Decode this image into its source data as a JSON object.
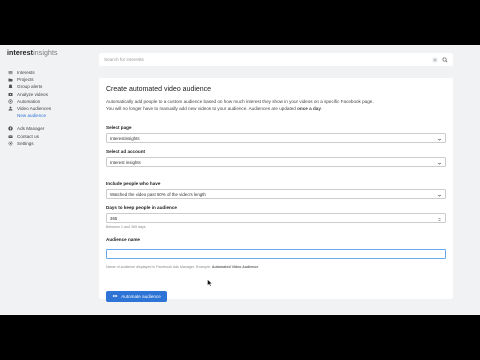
{
  "app": {
    "logo_bold": "interest",
    "logo_light": "insights"
  },
  "sidebar": {
    "items": [
      {
        "label": "Interests",
        "icon": "list-icon"
      },
      {
        "label": "Projects",
        "icon": "folder-icon"
      },
      {
        "label": "Group alerts",
        "icon": "bell-icon"
      },
      {
        "label": "Analyze videos",
        "icon": "video-icon"
      },
      {
        "label": "Automation",
        "icon": "automation-icon"
      },
      {
        "label": "Video Audiences",
        "icon": "users-icon"
      },
      {
        "label": "New audience",
        "icon": ""
      }
    ],
    "bottom_items": [
      {
        "label": "Ads Manager",
        "icon": "facebook-icon"
      },
      {
        "label": "Contact us",
        "icon": "mail-icon"
      },
      {
        "label": "Settings",
        "icon": "gear-icon"
      }
    ]
  },
  "search": {
    "placeholder": "Search for interests"
  },
  "form": {
    "title": "Create automated video audience",
    "desc_line1": "Automatically add people to a custom audience based on how much interest they show in your videos on a specific Facebook page.",
    "desc_line2_pre": "You will no longer have to manually add new videos to your audience. Audiences are updated ",
    "desc_line2_bold": "once a day",
    "desc_line2_post": ".",
    "page_label": "Select page",
    "page_value": "Interestinsights",
    "ad_account_label": "Select ad account",
    "ad_account_value": "Interest insights",
    "include_label": "Include people who have",
    "include_value": "Watched the video past 50% of the video's length",
    "days_label": "Days to keep people in audience",
    "days_value": "365",
    "days_helper": "Between 1 and 365 days",
    "audience_label": "Audience name",
    "audience_value": "",
    "audience_helper_pre": "Name of audience displayed in Facebook Ads Manager. Example: ",
    "audience_helper_bold": "Automated Video Audience",
    "submit_label": "Automate audience"
  }
}
